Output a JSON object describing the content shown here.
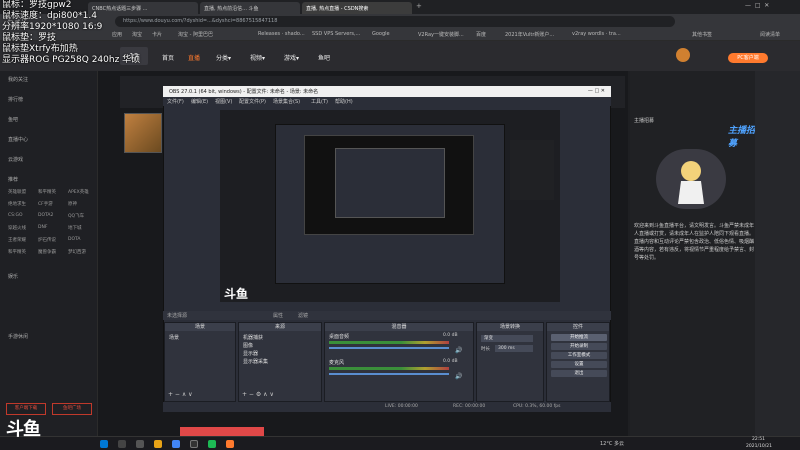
{
  "browser": {
    "tabs": [
      {
        "label": "CNBC热点话题三步骤 ..."
      },
      {
        "label": "直播, 热点前沿信... 斗鱼"
      },
      {
        "label": "直播, 热点直播 - CSDN搜索"
      }
    ],
    "url": "https://www.douyu.com/?dyshid=...&dyshci=8867515847118",
    "bookmarks": [
      "应用",
      "淘宝",
      "卡片",
      "淘宝 - 阿里巴巴",
      "Releases · shado...",
      "SSD VPS Servers,...",
      "Google",
      "V2Ray一键安装脚...",
      "百度",
      "2021年Vultr新账户...",
      "v2ray wordls · tra...",
      "其他书签",
      "阅读清单"
    ]
  },
  "overlay_text": [
    "鼠标：罗技gpw2",
    "鼠标速度：dpi800*1.4",
    "分辨率1920*1080 16:9",
    "鼠标垫：罗技",
    "鼠标垫Xtrfy布加热",
    "显示器ROG PG258Q 240hz 华硕"
  ],
  "site": {
    "nav": [
      "首页",
      "直播",
      "分类▾",
      "视频▾",
      "游戏▾",
      "鱼吧"
    ],
    "active_nav": "直播",
    "badge": "12",
    "right_buttons": [
      "PC客户端",
      "下载"
    ]
  },
  "sidebar": {
    "items": [
      "我的关注",
      "排行榜",
      "鱼吧",
      "直播中心",
      "云游戏",
      "推荐"
    ],
    "game_cols": [
      [
        "英雄联盟",
        "绝地求生",
        "CS:GO",
        "穿越火线",
        "王者荣耀",
        "和平精英"
      ],
      [
        "和平精英",
        "CF手游",
        "DOTA2",
        "DNF",
        "炉石传说",
        "魔兽争霸"
      ],
      [
        "APEX英雄",
        "原神",
        "QQ飞车",
        "地下城",
        "DOTA",
        "梦幻西游"
      ]
    ],
    "sections": [
      "娱乐",
      "手游休闲"
    ],
    "bottom_buttons": [
      "客户端下载",
      "鱼吧广场"
    ]
  },
  "obs": {
    "title": "OBS 27.0.1 (64 bit, windows) - 配置文件: 未命名 - 场景: 未命名",
    "menu": [
      "文件(F)",
      "编辑(E)",
      "视图(V)",
      "配置文件(P)",
      "场景集合(S)",
      "工具(T)",
      "帮助(H)"
    ],
    "no_source": "未选择源",
    "properties": "属性",
    "filters": "滤镜",
    "docks": {
      "scenes": {
        "title": "场景",
        "items": [
          "场景"
        ]
      },
      "sources": {
        "title": "来源",
        "items": [
          "机器捕获",
          "图像",
          "显示器",
          "显示器采集"
        ]
      },
      "mixer": {
        "title": "混音器",
        "channels": [
          {
            "name": "桌面音频",
            "db": "0.0 dB"
          },
          {
            "name": "麦克风",
            "db": "0.0 dB"
          }
        ]
      },
      "transitions": {
        "title": "场景转换",
        "type": "渐变",
        "duration_label": "时长",
        "duration": "300 ms"
      },
      "controls": {
        "title": "控件",
        "buttons": [
          "开始推流",
          "开始录制",
          "工作室模式",
          "设置",
          "退出"
        ]
      }
    },
    "status": {
      "live": "LIVE: 00:00:00",
      "rec": "REC: 00:00:00",
      "cpu": "CPU: 0.3%, 60.00 fps"
    }
  },
  "streamer_notice": "欢迎来到斗鱼直播平台，请文明发言。斗鱼严禁未成年人直播或打赏，请未成年人在监护人陪同下观看直播。直播内容和互动评论严禁包含政治、低俗色情、吸烟酗酒等内容，若有违反，将视情节严重程度给予禁言、封号等处罚。",
  "chat_label": "主播招募",
  "banner_text": "主播招募",
  "taskbar": {
    "weather": "12°C 多云",
    "time": "22:51",
    "date": "2021/10/21"
  },
  "logo": "斗鱼"
}
